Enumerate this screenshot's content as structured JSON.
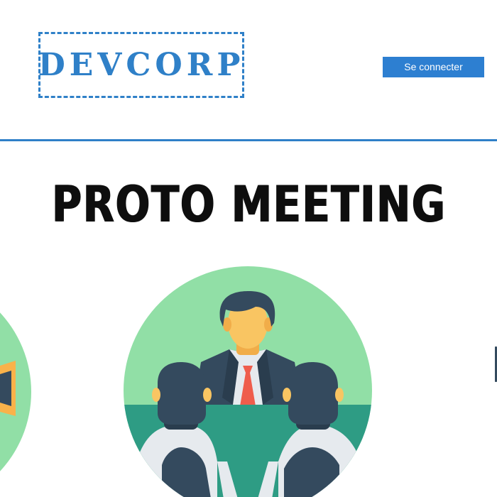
{
  "header": {
    "logo_text": "DEVCORP",
    "login_label": "Se connecter"
  },
  "hero": {
    "title": "PROTO MEETING"
  },
  "illustration": {
    "icon": "meeting-illustration-icon",
    "colors": {
      "circle": "#91dfa6",
      "table": "#2e9c84",
      "hair": "#344a5e",
      "skin": "#f9c562",
      "tie": "#ef5d4c",
      "shirt": "#e6eaee"
    }
  },
  "colors": {
    "accent": "#2f80c8",
    "button": "#2d7fd1"
  }
}
